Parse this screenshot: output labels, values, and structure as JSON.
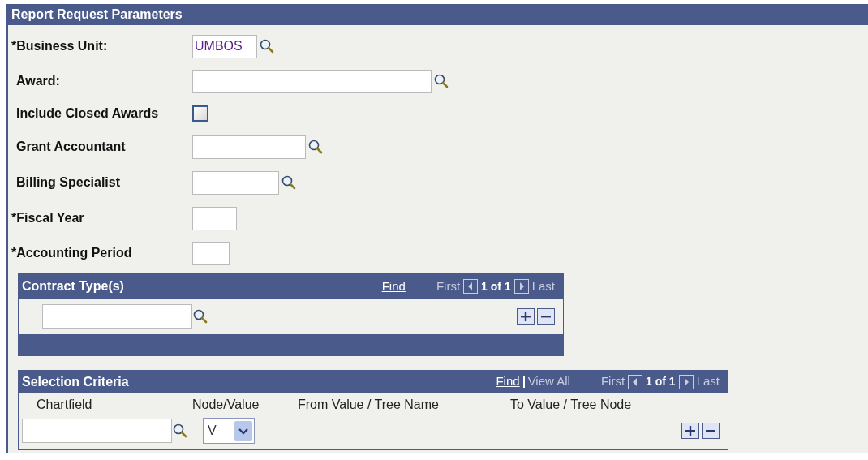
{
  "section": {
    "title": "Report Request Parameters"
  },
  "fields": [
    {
      "kind": "lookup",
      "label": "*Business Unit:",
      "value": "UMBOS"
    },
    {
      "kind": "lookup",
      "label": "Award:"
    },
    {
      "kind": "checkbox",
      "label": "Include Closed Awards",
      "checked": false
    },
    {
      "kind": "lookup",
      "label": "Grant Accountant"
    },
    {
      "kind": "lookup",
      "label": "Billing Specialist"
    },
    {
      "kind": "text",
      "label": "*Fiscal Year"
    },
    {
      "kind": "text",
      "label": "*Accounting Period"
    }
  ],
  "contract_grid": {
    "title": "Contract Type(s)",
    "links": [
      {
        "label": "Find",
        "disabled": false
      }
    ],
    "nav": {
      "first": "First",
      "first_disabled": true,
      "count": "1 of 1",
      "last": "Last",
      "last_disabled": true
    }
  },
  "selection_grid": {
    "title": "Selection Criteria",
    "links": [
      {
        "label": "Find",
        "disabled": false
      },
      {
        "label": "View All",
        "disabled": true
      }
    ],
    "nav": {
      "first": "First",
      "first_disabled": true,
      "count": "1 of 1",
      "last": "Last",
      "last_disabled": true
    },
    "columns": [
      "Chartfield",
      "Node/Value",
      "From Value / Tree Name",
      "To Value / Tree Node"
    ],
    "row": {
      "node_value": "V"
    }
  }
}
